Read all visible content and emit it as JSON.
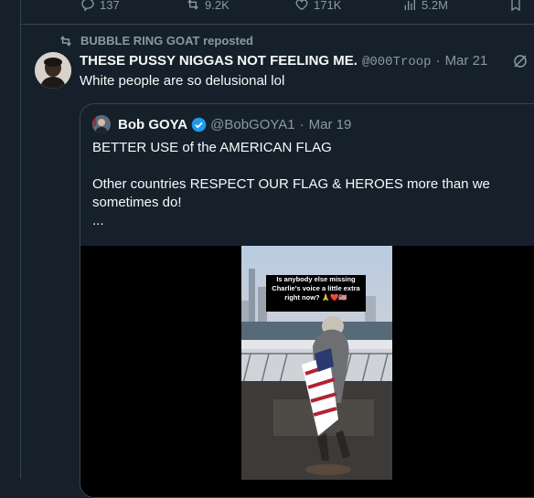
{
  "actions": {
    "replies": "137",
    "reposts": "9.2K",
    "likes": "171K",
    "views": "5.2M"
  },
  "repost_label": "BUBBLE RING GOAT reposted",
  "tweet": {
    "name": "THESE PUSSY NIGGAS NOT FEELING ME.",
    "handle": "@000Troop",
    "dot": "·",
    "date": "Mar 21",
    "text": "White people are so delusional lol"
  },
  "quote": {
    "name": "Bob GOYA",
    "handle": "@BobGOYA1",
    "dot": "·",
    "date": "Mar 19",
    "line1": "BETTER USE of the AMERICAN FLAG",
    "line2": "Other countries RESPECT OUR FLAG & HEROES more than we sometimes do!",
    "more": "...",
    "video_caption": "Is anybody else missing Charlie's voice a little extra right now? 🙏❤️🇺🇸"
  },
  "colors": {
    "background": "#15202b",
    "border": "#38444d",
    "secondary_text": "#8b98a5",
    "verified_blue": "#1d9bf0"
  }
}
